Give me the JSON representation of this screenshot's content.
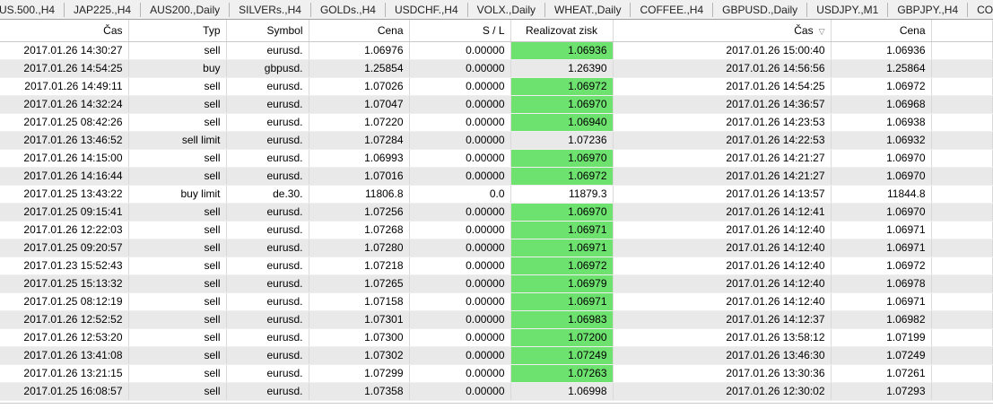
{
  "tabs": [
    "US.500.,H4",
    "JAP225.,H4",
    "AUS200.,Daily",
    "SILVERs.,H4",
    "GOLDs.,H4",
    "USDCHF.,H4",
    "VOLX.,Daily",
    "WHEAT.,Daily",
    "COFFEE.,H4",
    "GBPUSD.,Daily",
    "USDJPY.,M1",
    "GBPJPY.,H4",
    "CORN.,Daily"
  ],
  "columns": [
    "Čas",
    "Typ",
    "Symbol",
    "Cena",
    "S / L",
    "Realizovat zisk",
    "Čas",
    "Cena"
  ],
  "sort_icon": "sort-down-icon",
  "colors": {
    "profit_highlight": "#6ee26e",
    "row_alt": "#e9e9e9"
  },
  "rows": [
    {
      "open_time": "2017.01.26 14:30:27",
      "type": "sell",
      "symbol": "eurusd.",
      "price": "1.06976",
      "sl": "0.00000",
      "tp": "1.06936",
      "close_time": "2017.01.26 15:00:40",
      "close_price": "1.06936",
      "hit": true
    },
    {
      "open_time": "2017.01.26 14:54:25",
      "type": "buy",
      "symbol": "gbpusd.",
      "price": "1.25854",
      "sl": "0.00000",
      "tp": "1.26390",
      "close_time": "2017.01.26 14:56:56",
      "close_price": "1.25864",
      "hit": false
    },
    {
      "open_time": "2017.01.26 14:49:11",
      "type": "sell",
      "symbol": "eurusd.",
      "price": "1.07026",
      "sl": "0.00000",
      "tp": "1.06972",
      "close_time": "2017.01.26 14:54:25",
      "close_price": "1.06972",
      "hit": true
    },
    {
      "open_time": "2017.01.26 14:32:24",
      "type": "sell",
      "symbol": "eurusd.",
      "price": "1.07047",
      "sl": "0.00000",
      "tp": "1.06970",
      "close_time": "2017.01.26 14:36:57",
      "close_price": "1.06968",
      "hit": true
    },
    {
      "open_time": "2017.01.25 08:42:26",
      "type": "sell",
      "symbol": "eurusd.",
      "price": "1.07220",
      "sl": "0.00000",
      "tp": "1.06940",
      "close_time": "2017.01.26 14:23:53",
      "close_price": "1.06938",
      "hit": true
    },
    {
      "open_time": "2017.01.26 13:46:52",
      "type": "sell limit",
      "symbol": "eurusd.",
      "price": "1.07284",
      "sl": "0.00000",
      "tp": "1.07236",
      "close_time": "2017.01.26 14:22:53",
      "close_price": "1.06932",
      "hit": false
    },
    {
      "open_time": "2017.01.26 14:15:00",
      "type": "sell",
      "symbol": "eurusd.",
      "price": "1.06993",
      "sl": "0.00000",
      "tp": "1.06970",
      "close_time": "2017.01.26 14:21:27",
      "close_price": "1.06970",
      "hit": true
    },
    {
      "open_time": "2017.01.26 14:16:44",
      "type": "sell",
      "symbol": "eurusd.",
      "price": "1.07016",
      "sl": "0.00000",
      "tp": "1.06972",
      "close_time": "2017.01.26 14:21:27",
      "close_price": "1.06970",
      "hit": true
    },
    {
      "open_time": "2017.01.25 13:43:22",
      "type": "buy limit",
      "symbol": "de.30.",
      "price": "11806.8",
      "sl": "0.0",
      "tp": "11879.3",
      "close_time": "2017.01.26 14:13:57",
      "close_price": "11844.8",
      "hit": false
    },
    {
      "open_time": "2017.01.25 09:15:41",
      "type": "sell",
      "symbol": "eurusd.",
      "price": "1.07256",
      "sl": "0.00000",
      "tp": "1.06970",
      "close_time": "2017.01.26 14:12:41",
      "close_price": "1.06970",
      "hit": true
    },
    {
      "open_time": "2017.01.26 12:22:03",
      "type": "sell",
      "symbol": "eurusd.",
      "price": "1.07268",
      "sl": "0.00000",
      "tp": "1.06971",
      "close_time": "2017.01.26 14:12:40",
      "close_price": "1.06971",
      "hit": true
    },
    {
      "open_time": "2017.01.25 09:20:57",
      "type": "sell",
      "symbol": "eurusd.",
      "price": "1.07280",
      "sl": "0.00000",
      "tp": "1.06971",
      "close_time": "2017.01.26 14:12:40",
      "close_price": "1.06971",
      "hit": true
    },
    {
      "open_time": "2017.01.23 15:52:43",
      "type": "sell",
      "symbol": "eurusd.",
      "price": "1.07218",
      "sl": "0.00000",
      "tp": "1.06972",
      "close_time": "2017.01.26 14:12:40",
      "close_price": "1.06972",
      "hit": true
    },
    {
      "open_time": "2017.01.25 15:13:32",
      "type": "sell",
      "symbol": "eurusd.",
      "price": "1.07265",
      "sl": "0.00000",
      "tp": "1.06979",
      "close_time": "2017.01.26 14:12:40",
      "close_price": "1.06978",
      "hit": true
    },
    {
      "open_time": "2017.01.25 08:12:19",
      "type": "sell",
      "symbol": "eurusd.",
      "price": "1.07158",
      "sl": "0.00000",
      "tp": "1.06971",
      "close_time": "2017.01.26 14:12:40",
      "close_price": "1.06971",
      "hit": true
    },
    {
      "open_time": "2017.01.26 12:52:52",
      "type": "sell",
      "symbol": "eurusd.",
      "price": "1.07301",
      "sl": "0.00000",
      "tp": "1.06983",
      "close_time": "2017.01.26 14:12:37",
      "close_price": "1.06982",
      "hit": true
    },
    {
      "open_time": "2017.01.26 12:53:20",
      "type": "sell",
      "symbol": "eurusd.",
      "price": "1.07300",
      "sl": "0.00000",
      "tp": "1.07200",
      "close_time": "2017.01.26 13:58:12",
      "close_price": "1.07199",
      "hit": true
    },
    {
      "open_time": "2017.01.26 13:41:08",
      "type": "sell",
      "symbol": "eurusd.",
      "price": "1.07302",
      "sl": "0.00000",
      "tp": "1.07249",
      "close_time": "2017.01.26 13:46:30",
      "close_price": "1.07249",
      "hit": true
    },
    {
      "open_time": "2017.01.26 13:21:15",
      "type": "sell",
      "symbol": "eurusd.",
      "price": "1.07299",
      "sl": "0.00000",
      "tp": "1.07263",
      "close_time": "2017.01.26 13:30:36",
      "close_price": "1.07261",
      "hit": true
    },
    {
      "open_time": "2017.01.25 16:08:57",
      "type": "sell",
      "symbol": "eurusd.",
      "price": "1.07358",
      "sl": "0.00000",
      "tp": "1.06998",
      "close_time": "2017.01.26 12:30:02",
      "close_price": "1.07293",
      "hit": false
    }
  ]
}
